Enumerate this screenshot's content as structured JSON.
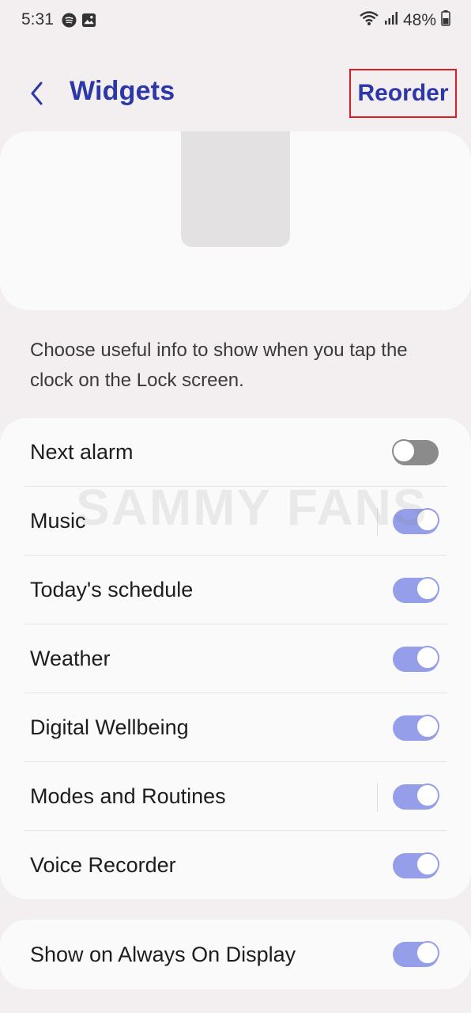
{
  "status_bar": {
    "time": "5:31",
    "battery": "48%",
    "icons": [
      "spotify-icon",
      "gallery-icon",
      "wifi-icon",
      "signal-icon",
      "battery-icon"
    ]
  },
  "header": {
    "title": "Widgets",
    "reorder_label": "Reorder",
    "accent_color": "#2c37a8",
    "highlight_color": "#e01b24"
  },
  "description": "Choose useful info to show when you tap the clock on the Lock screen.",
  "widgets": [
    {
      "label": "Next alarm",
      "enabled": false
    },
    {
      "label": "Music",
      "enabled": true
    },
    {
      "label": "Today's schedule",
      "enabled": true
    },
    {
      "label": "Weather",
      "enabled": true
    },
    {
      "label": "Digital Wellbeing",
      "enabled": true
    },
    {
      "label": "Modes and Routines",
      "enabled": true
    },
    {
      "label": "Voice Recorder",
      "enabled": true
    }
  ],
  "always_on_display": {
    "label": "Show on Always On Display",
    "enabled": true
  },
  "watermark": "SAMMY FANS"
}
